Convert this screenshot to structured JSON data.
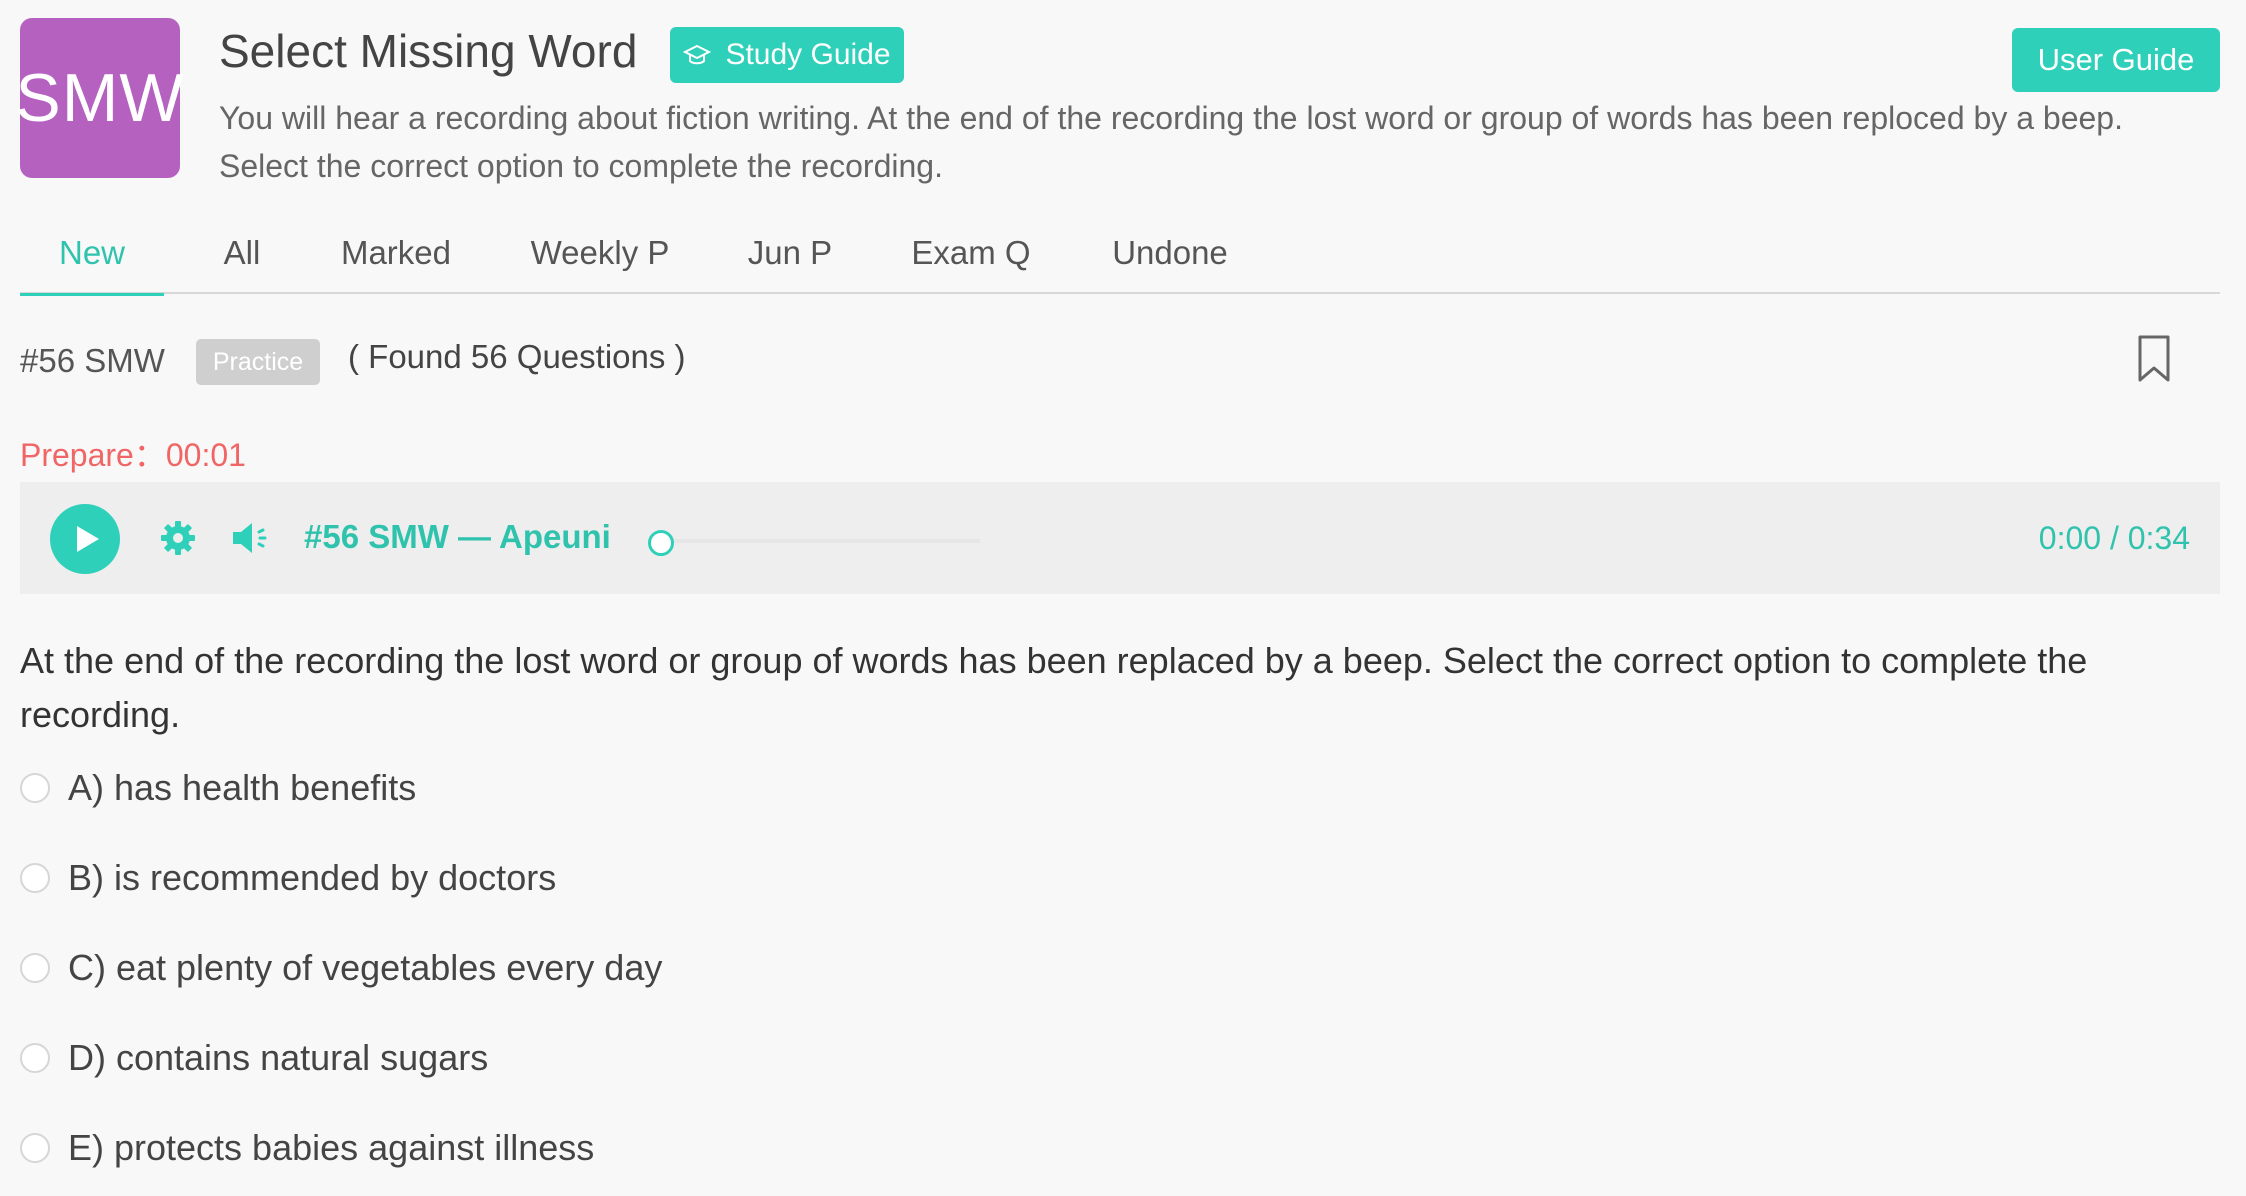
{
  "header": {
    "logo_text": "SMW",
    "title": "Select Missing Word",
    "study_guide_label": "Study Guide",
    "user_guide_label": "User Guide",
    "description": "You will hear a recording about fiction writing. At the end of the recording the lost word or group of words has been reploced by a beep. Select the correct option to complete the recording."
  },
  "tabs": [
    {
      "label": "New",
      "active": true
    },
    {
      "label": "All",
      "active": false
    },
    {
      "label": "Marked",
      "active": false
    },
    {
      "label": "Weekly P",
      "active": false
    },
    {
      "label": "Jun P",
      "active": false
    },
    {
      "label": "Exam Q",
      "active": false
    },
    {
      "label": "Undone",
      "active": false
    }
  ],
  "question_meta": {
    "number": "#56 SMW",
    "badge": "Practice",
    "found": "( Found 56 Questions )"
  },
  "prepare": "Prepare：00:01",
  "player": {
    "track_title": "#56 SMW — Apeuni",
    "time": "0:00 / 0:34",
    "progress": 0
  },
  "question": {
    "text": "At the end of the recording the lost word or group of words has been replaced by a beep. Select the correct option to complete the recording.",
    "options": [
      "A) has health benefits",
      "B) is recommended by doctors",
      "C) eat plenty of vegetables every day",
      "D) contains natural sugars",
      "E) protects babies against illness"
    ]
  },
  "colors": {
    "accent": "#2fd0b9",
    "logo_bg": "#b461c0",
    "prepare_text": "#f06565",
    "badge_bg": "#cfcfcf"
  },
  "icons": [
    "graduation-cap-icon",
    "bookmark-icon",
    "play-icon",
    "gear-icon",
    "speaker-icon"
  ]
}
